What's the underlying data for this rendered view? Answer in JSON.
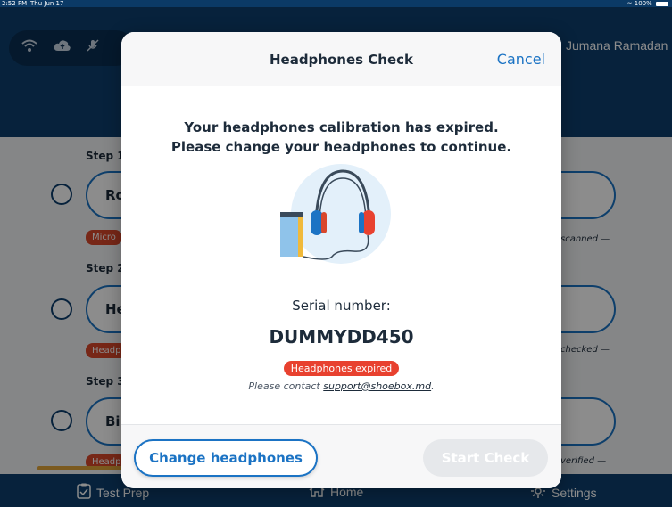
{
  "status_bar": {
    "time": "2:52 PM",
    "date": "Thu Jun 17",
    "battery": "100%"
  },
  "header": {
    "user_name": "Jumana Ramadan",
    "icons": [
      "wifi-icon",
      "cloud-upload-icon",
      "no-microphone-icon"
    ]
  },
  "steps": [
    {
      "label": "Step 1",
      "card_text": "Ro",
      "badge": "Micro",
      "status": "scanned —"
    },
    {
      "label": "Step 2",
      "card_text": "He",
      "badge": "Headp",
      "status": "checked —"
    },
    {
      "label": "Step 3",
      "card_text": "Bi",
      "badge": "Headp",
      "status": "verified —"
    }
  ],
  "tabbar": {
    "tabs": [
      {
        "label": "Test Prep",
        "icon": "clipboard-check-icon"
      },
      {
        "label": "Home",
        "icon": "home-icon"
      },
      {
        "label": "Settings",
        "icon": "gear-icon"
      }
    ]
  },
  "modal": {
    "title": "Headphones Check",
    "cancel_label": "Cancel",
    "message_line1": "Your headphones calibration has expired.",
    "message_line2": "Please change your headphones to continue.",
    "serial_label": "Serial number:",
    "serial_value": "DUMMYDD450",
    "expired_badge": "Headphones expired",
    "contact_prefix": "Please contact ",
    "contact_email": "support@shoebox.md",
    "contact_suffix": ".",
    "change_button": "Change headphones",
    "start_button": "Start Check"
  },
  "colors": {
    "primary": "#1b73c4",
    "navy": "#0d3f6e",
    "alert": "#e8412f",
    "accent": "#e0a53a"
  }
}
